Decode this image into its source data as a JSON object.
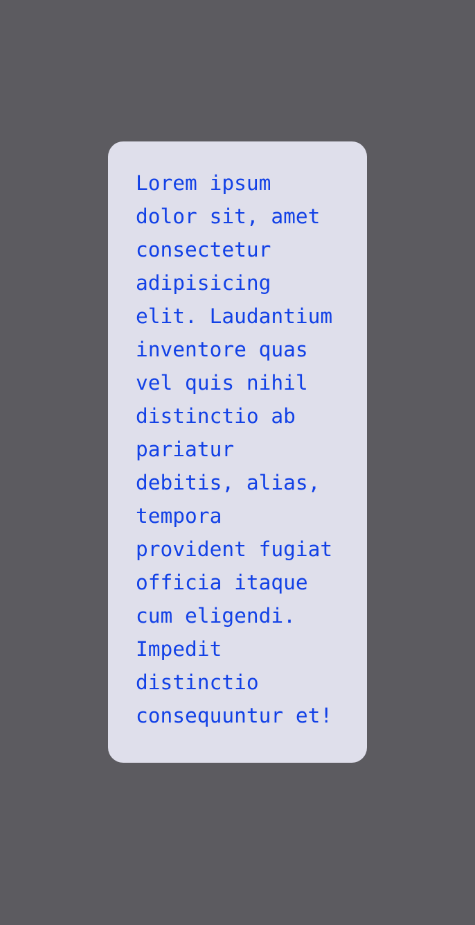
{
  "card": {
    "lines": [
      "Lorem ipsum",
      "dolor sit, amet",
      "consectetur",
      "adipisicing",
      "elit. Laudantium",
      "inventore quas",
      "vel quis nihil",
      "distinctio ab",
      "pariatur",
      "debitis, alias,",
      "tempora",
      "provident fugiat",
      "officia itaque",
      "cum eligendi.",
      "Impedit",
      "distinctio",
      "consequuntur et!"
    ]
  },
  "colors": {
    "background": "#5c5b60",
    "card": "#dfdfeb",
    "text": "#1241e6"
  }
}
